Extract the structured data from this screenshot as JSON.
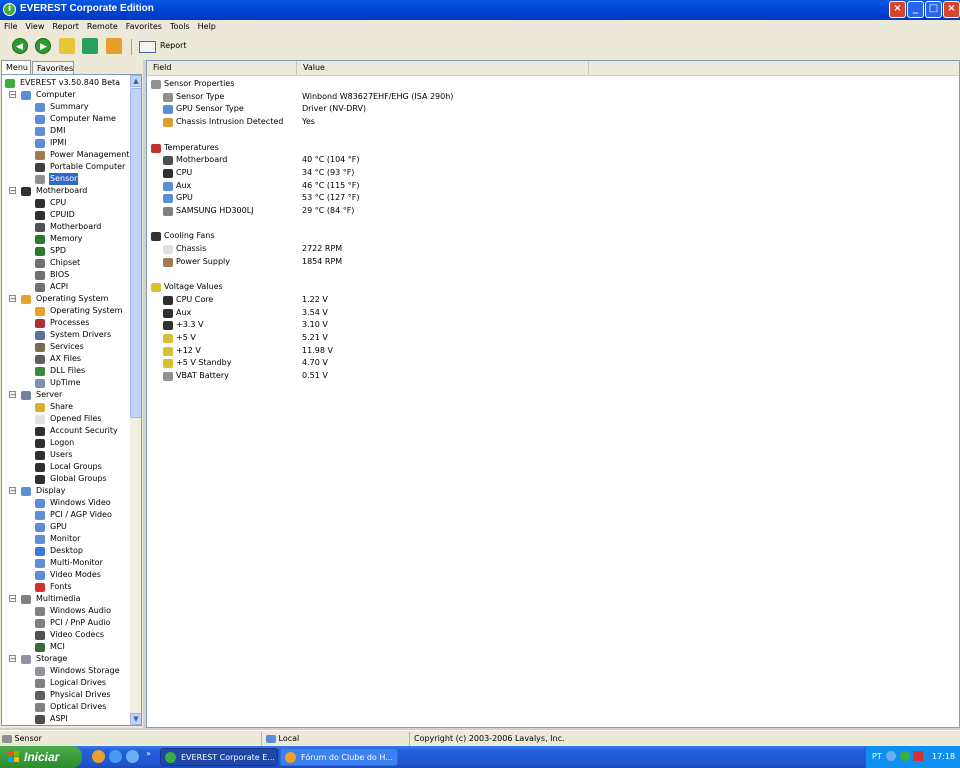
{
  "window": {
    "title": "EVEREST Corporate Edition"
  },
  "menubar": [
    "File",
    "View",
    "Report",
    "Remote",
    "Favorites",
    "Tools",
    "Help"
  ],
  "toolbar": {
    "report_label": "Report"
  },
  "left_tabs": [
    "Menu",
    "Favorites"
  ],
  "tree": [
    {
      "label": "EVEREST v3.50.840 Beta",
      "level": 0,
      "icon": "everest-icon",
      "color": "#3fae3f"
    },
    {
      "label": "Computer",
      "level": 1,
      "icon": "computer-icon",
      "color": "#5a8fd8",
      "expanded": true
    },
    {
      "label": "Summary",
      "level": 2,
      "icon": "computer-icon",
      "color": "#5a8fd8"
    },
    {
      "label": "Computer Name",
      "level": 2,
      "icon": "computer-icon",
      "color": "#5a8fd8"
    },
    {
      "label": "DMI",
      "level": 2,
      "icon": "computer-icon",
      "color": "#5a8fd8"
    },
    {
      "label": "IPMI",
      "level": 2,
      "icon": "computer-icon",
      "color": "#5a8fd8"
    },
    {
      "label": "Power Management",
      "level": 2,
      "icon": "power-icon",
      "color": "#a07a50"
    },
    {
      "label": "Portable Computer",
      "level": 2,
      "icon": "laptop-icon",
      "color": "#404040"
    },
    {
      "label": "Sensor",
      "level": 2,
      "icon": "sensor-icon",
      "color": "#909090",
      "selected": true
    },
    {
      "label": "Motherboard",
      "level": 1,
      "icon": "chip-icon",
      "color": "#303030",
      "expanded": true
    },
    {
      "label": "CPU",
      "level": 2,
      "icon": "chip-icon",
      "color": "#303030"
    },
    {
      "label": "CPUID",
      "level": 2,
      "icon": "chip-icon",
      "color": "#303030"
    },
    {
      "label": "Motherboard",
      "level": 2,
      "icon": "chip-icon",
      "color": "#505050"
    },
    {
      "label": "Memory",
      "level": 2,
      "icon": "memory-icon",
      "color": "#2a7a2a"
    },
    {
      "label": "SPD",
      "level": 2,
      "icon": "memory-icon",
      "color": "#2a7a2a"
    },
    {
      "label": "Chipset",
      "level": 2,
      "icon": "chip-icon",
      "color": "#707070"
    },
    {
      "label": "BIOS",
      "level": 2,
      "icon": "chip-icon",
      "color": "#707070"
    },
    {
      "label": "ACPI",
      "level": 2,
      "icon": "chip-icon",
      "color": "#707070"
    },
    {
      "label": "Operating System",
      "level": 1,
      "icon": "windows-icon",
      "color": "#e8a030",
      "expanded": true
    },
    {
      "label": "Operating System",
      "level": 2,
      "icon": "windows-icon",
      "color": "#e8a030"
    },
    {
      "label": "Processes",
      "level": 2,
      "icon": "process-icon",
      "color": "#b03030"
    },
    {
      "label": "System Drivers",
      "level": 2,
      "icon": "driver-icon",
      "color": "#6070a0"
    },
    {
      "label": "Services",
      "level": 2,
      "icon": "services-icon",
      "color": "#707050"
    },
    {
      "label": "AX Files",
      "level": 2,
      "icon": "file-icon",
      "color": "#606060"
    },
    {
      "label": "DLL Files",
      "level": 2,
      "icon": "file-icon",
      "color": "#3a8a3a"
    },
    {
      "label": "UpTime",
      "level": 2,
      "icon": "clock-icon",
      "color": "#8090b0"
    },
    {
      "label": "Server",
      "level": 1,
      "icon": "server-icon",
      "color": "#7080a0",
      "expanded": true
    },
    {
      "label": "Share",
      "level": 2,
      "icon": "share-icon",
      "color": "#d8b030"
    },
    {
      "label": "Opened Files",
      "level": 2,
      "icon": "file-icon",
      "color": "#e0e0e0"
    },
    {
      "label": "Account Security",
      "level": 2,
      "icon": "user-icon",
      "color": "#303030"
    },
    {
      "label": "Logon",
      "level": 2,
      "icon": "user-icon",
      "color": "#303030"
    },
    {
      "label": "Users",
      "level": 2,
      "icon": "user-icon",
      "color": "#303030"
    },
    {
      "label": "Local Groups",
      "level": 2,
      "icon": "group-icon",
      "color": "#303030"
    },
    {
      "label": "Global Groups",
      "level": 2,
      "icon": "group-icon",
      "color": "#303030"
    },
    {
      "label": "Display",
      "level": 1,
      "icon": "display-icon",
      "color": "#5a8fd8",
      "expanded": true
    },
    {
      "label": "Windows Video",
      "level": 2,
      "icon": "display-icon",
      "color": "#5a8fd8"
    },
    {
      "label": "PCI / AGP Video",
      "level": 2,
      "icon": "display-icon",
      "color": "#5a8fd8"
    },
    {
      "label": "GPU",
      "level": 2,
      "icon": "display-icon",
      "color": "#5a8fd8"
    },
    {
      "label": "Monitor",
      "level": 2,
      "icon": "monitor-icon",
      "color": "#5a8fd8"
    },
    {
      "label": "Desktop",
      "level": 2,
      "icon": "desktop-icon",
      "color": "#3a7ad8"
    },
    {
      "label": "Multi-Monitor",
      "level": 2,
      "icon": "monitor-icon",
      "color": "#5a8fd8"
    },
    {
      "label": "Video Modes",
      "level": 2,
      "icon": "display-icon",
      "color": "#5a8fd8"
    },
    {
      "label": "Fonts",
      "level": 2,
      "icon": "font-icon",
      "color": "#d83030"
    },
    {
      "label": "Multimedia",
      "level": 1,
      "icon": "audio-icon",
      "color": "#808080",
      "expanded": true
    },
    {
      "label": "Windows Audio",
      "level": 2,
      "icon": "audio-icon",
      "color": "#808080"
    },
    {
      "label": "PCI / PnP Audio",
      "level": 2,
      "icon": "audio-icon",
      "color": "#808080"
    },
    {
      "label": "Video Codecs",
      "level": 2,
      "icon": "codec-icon",
      "color": "#505050"
    },
    {
      "label": "MCI",
      "level": 2,
      "icon": "mci-icon",
      "color": "#3a6a3a"
    },
    {
      "label": "Storage",
      "level": 1,
      "icon": "storage-icon",
      "color": "#9090a0",
      "expanded": true
    },
    {
      "label": "Windows Storage",
      "level": 2,
      "icon": "storage-icon",
      "color": "#9090a0"
    },
    {
      "label": "Logical Drives",
      "level": 2,
      "icon": "drive-icon",
      "color": "#808080"
    },
    {
      "label": "Physical Drives",
      "level": 2,
      "icon": "drive-icon",
      "color": "#606060"
    },
    {
      "label": "Optical Drives",
      "level": 2,
      "icon": "optical-icon",
      "color": "#808080"
    },
    {
      "label": "ASPI",
      "level": 2,
      "icon": "chip-icon",
      "color": "#505050"
    }
  ],
  "columns": {
    "field": "Field",
    "value": "Value"
  },
  "sections": [
    {
      "label": "Sensor Properties",
      "icon": "sensor-icon",
      "color": "#909090",
      "rows": [
        {
          "field": "Sensor Type",
          "value": "Winbond W83627EHF/EHG  (ISA 290h)",
          "icon": "sensor-icon",
          "color": "#909090"
        },
        {
          "field": "GPU Sensor Type",
          "value": "Driver  (NV-DRV)",
          "icon": "display-icon",
          "color": "#5a8fd8"
        },
        {
          "field": "Chassis Intrusion Detected",
          "value": "Yes",
          "icon": "lock-icon",
          "color": "#d8a030"
        }
      ]
    },
    {
      "label": "Temperatures",
      "icon": "thermometer-icon",
      "color": "#c03030",
      "rows": [
        {
          "field": "Motherboard",
          "value": "40 °C  (104 °F)",
          "icon": "chip-icon",
          "color": "#505050"
        },
        {
          "field": "CPU",
          "value": "34 °C  (93 °F)",
          "icon": "chip-icon",
          "color": "#303030"
        },
        {
          "field": "Aux",
          "value": "46 °C  (115 °F)",
          "icon": "computer-icon",
          "color": "#5a8fd8"
        },
        {
          "field": "GPU",
          "value": "53 °C  (127 °F)",
          "icon": "display-icon",
          "color": "#5a8fd8"
        },
        {
          "field": "SAMSUNG HD300LJ",
          "value": "29 °C  (84 °F)",
          "icon": "drive-icon",
          "color": "#808080"
        }
      ]
    },
    {
      "label": "Cooling Fans",
      "icon": "fan-icon",
      "color": "#303030",
      "rows": [
        {
          "field": "Chassis",
          "value": "2722 RPM",
          "icon": "chassis-icon",
          "color": "#e0e0e0"
        },
        {
          "field": "Power Supply",
          "value": "1854 RPM",
          "icon": "power-icon",
          "color": "#a07a50"
        }
      ]
    },
    {
      "label": "Voltage Values",
      "icon": "voltage-icon",
      "color": "#d8c030",
      "rows": [
        {
          "field": "CPU Core",
          "value": "1.22 V",
          "icon": "chip-icon",
          "color": "#303030"
        },
        {
          "field": "Aux",
          "value": "3.54 V",
          "icon": "chip-icon",
          "color": "#303030"
        },
        {
          "field": "+3.3 V",
          "value": "3.10 V",
          "icon": "chip-icon",
          "color": "#303030"
        },
        {
          "field": "+5 V",
          "value": "5.21 V",
          "icon": "voltage-icon",
          "color": "#d8c030"
        },
        {
          "field": "+12 V",
          "value": "11.98 V",
          "icon": "voltage-icon",
          "color": "#d8c030"
        },
        {
          "field": "+5 V Standby",
          "value": "4.70 V",
          "icon": "voltage-icon",
          "color": "#d8c030"
        },
        {
          "field": "VBAT Battery",
          "value": "0.51 V",
          "icon": "battery-icon",
          "color": "#909090"
        }
      ]
    }
  ],
  "statusbar": {
    "left": "Sensor",
    "middle": "Local",
    "right": "Copyright (c) 2003-2006 Lavalys, Inc."
  },
  "taskbar": {
    "start": "Iniciar",
    "tasks": [
      {
        "label": "EVEREST Corporate E...",
        "active": true
      },
      {
        "label": "Fórum do Clube do H...",
        "active": false
      }
    ],
    "tray": {
      "lang": "PT",
      "clock": "17:18"
    }
  }
}
